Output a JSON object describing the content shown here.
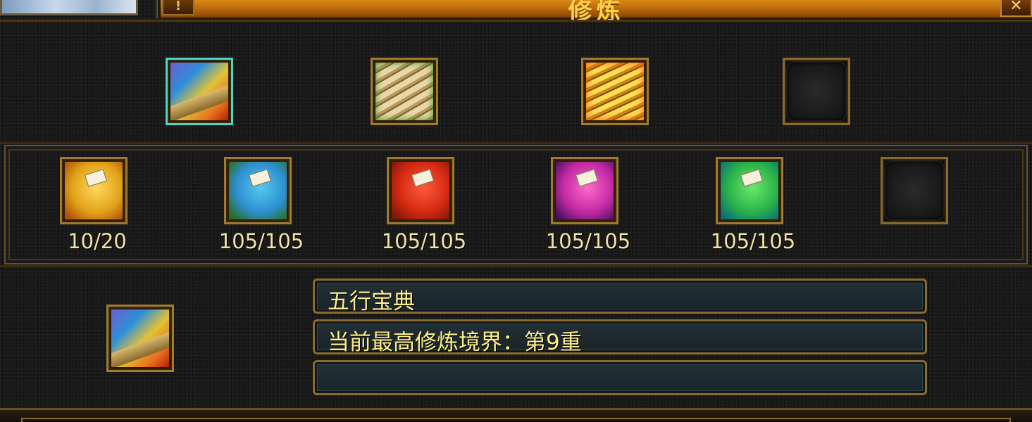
{
  "window": {
    "title": "修炼",
    "menu_glyph": "!",
    "close_glyph": "✕"
  },
  "top_slots": [
    {
      "icon": "rainbow-book-icon",
      "selected": true
    },
    {
      "icon": "scroll-bundle-icon",
      "selected": false
    },
    {
      "icon": "golden-scroll-bundle-icon",
      "selected": false
    },
    {
      "icon": "empty-slot-icon",
      "selected": false
    }
  ],
  "books": [
    {
      "icon": "yellow-book-icon",
      "count": "10/20"
    },
    {
      "icon": "blue-book-icon",
      "count": "105/105"
    },
    {
      "icon": "red-book-icon",
      "count": "105/105"
    },
    {
      "icon": "pink-book-icon",
      "count": "105/105"
    },
    {
      "icon": "green-book-icon",
      "count": "105/105"
    },
    {
      "icon": "empty-slot-icon",
      "count": ""
    }
  ],
  "detail": {
    "icon": "rainbow-book-icon",
    "name": "五行宝典",
    "realm": "当前最高修炼境界：第9重",
    "extra": ""
  },
  "colors": {
    "accent_orange": "#c86e0c",
    "text_gold": "#ffef8a",
    "selected_border": "#49d6c8"
  }
}
